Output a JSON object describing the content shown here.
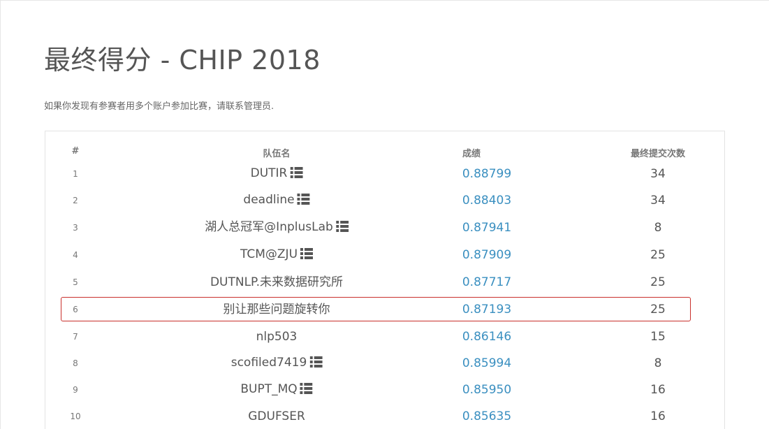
{
  "page": {
    "title": "最终得分 - CHIP 2018",
    "notice": "如果你发现有参赛者用多个账户参加比赛，请联系管理员."
  },
  "table": {
    "headers": {
      "rank": "#",
      "team": "队伍名",
      "score": "成绩",
      "count": "最终提交次数"
    },
    "rows": [
      {
        "rank": "1",
        "team": "DUTIR",
        "has_icon": true,
        "score": "0.88799",
        "count": "34"
      },
      {
        "rank": "2",
        "team": "deadline",
        "has_icon": true,
        "score": "0.88403",
        "count": "34"
      },
      {
        "rank": "3",
        "team": "湖人总冠军@InplusLab",
        "has_icon": true,
        "score": "0.87941",
        "count": "8"
      },
      {
        "rank": "4",
        "team": "TCM@ZJU",
        "has_icon": true,
        "score": "0.87909",
        "count": "25"
      },
      {
        "rank": "5",
        "team": "DUTNLP.未来数据研究所",
        "has_icon": false,
        "score": "0.87717",
        "count": "25"
      },
      {
        "rank": "6",
        "team": "别让那些问题旋转你",
        "has_icon": false,
        "score": "0.87193",
        "count": "25",
        "highlighted": true
      },
      {
        "rank": "7",
        "team": "nlp503",
        "has_icon": false,
        "score": "0.86146",
        "count": "15"
      },
      {
        "rank": "8",
        "team": "scofiled7419",
        "has_icon": true,
        "score": "0.85994",
        "count": "8"
      },
      {
        "rank": "9",
        "team": "BUPT_MQ",
        "has_icon": true,
        "score": "0.85950",
        "count": "16"
      },
      {
        "rank": "10",
        "team": "GDUFSER",
        "has_icon": false,
        "score": "0.85635",
        "count": "16"
      }
    ],
    "icon": "list-icon",
    "colors": {
      "score": "#3a8fc0",
      "highlight_border": "#c9302c"
    }
  }
}
